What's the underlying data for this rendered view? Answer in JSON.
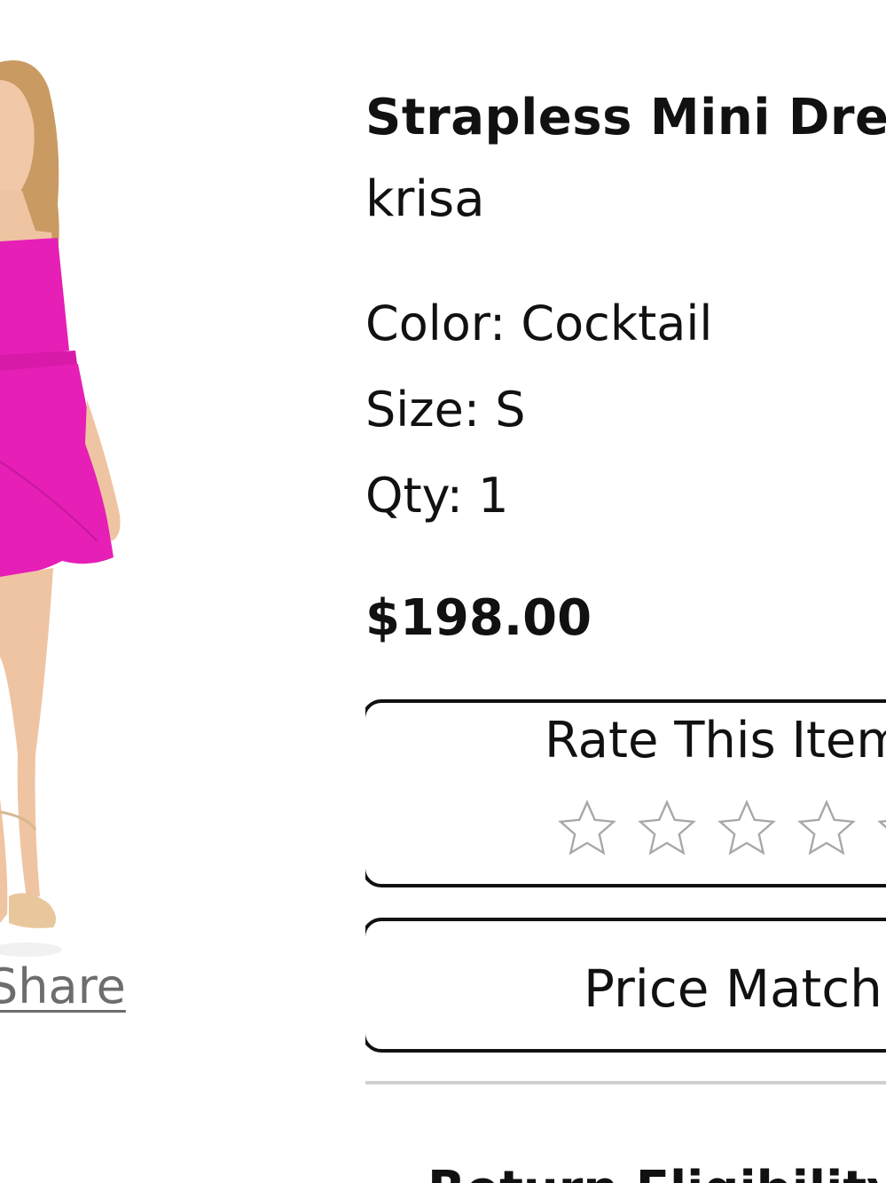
{
  "product": {
    "title": "Strapless Mini Dress",
    "brand": "krisa",
    "color_text": "Color: Cocktail",
    "size_text": "Size: S",
    "qty_text": "Qty: 1",
    "price": "$198.00"
  },
  "share": {
    "label": "Share"
  },
  "rating": {
    "label": "Rate This Item",
    "stars_total": 5,
    "stars_filled": 0
  },
  "price_match": {
    "label": "Price Match"
  },
  "returns": {
    "label": "Return Eligibility"
  },
  "colors": {
    "dress": "#e61fb6",
    "border": "#111111",
    "star": "#a8a8a8",
    "link": "#6d6d6d",
    "divider": "#d0d0d0"
  },
  "icons": {
    "star": "star-icon"
  }
}
